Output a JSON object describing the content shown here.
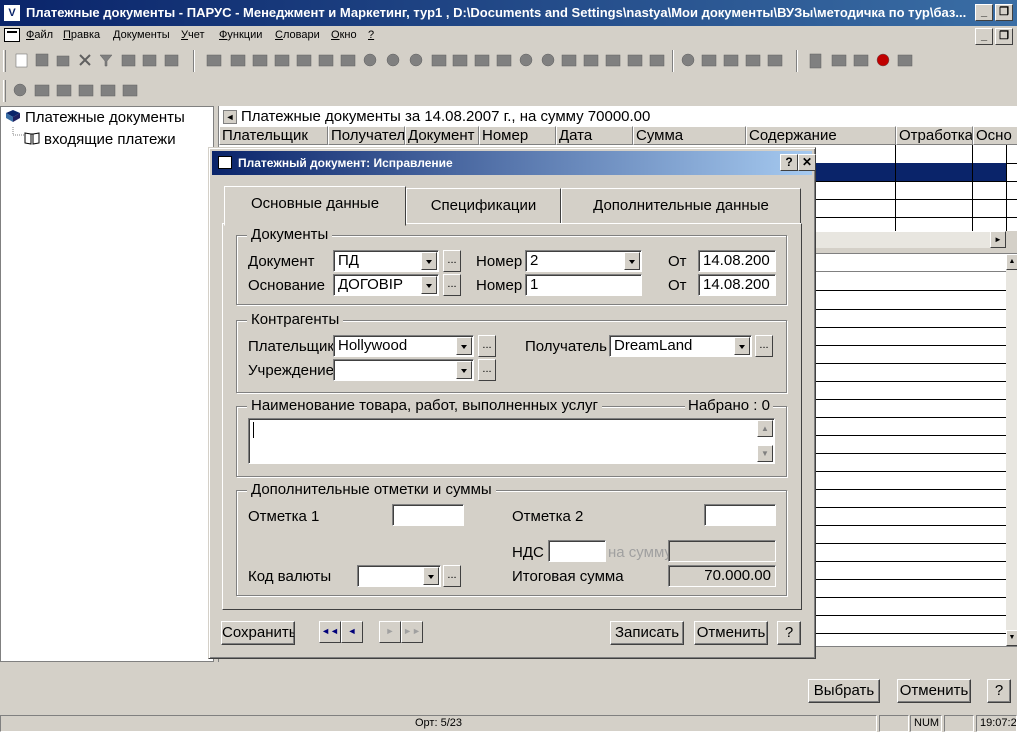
{
  "window": {
    "title": "Платежные документы - ПАРУС - Менеджмент и Маркетинг, тур1 , D:\\Documents and Settings\\nastya\\Мои документы\\ВУЗы\\методичка по тур\\баз...",
    "min_btn": "_",
    "restore_btn": "❐",
    "close_btn": "✕"
  },
  "menu": {
    "items": [
      {
        "u": "Ф",
        "rest": "айл"
      },
      {
        "u": "П",
        "rest": "равка"
      },
      {
        "u": "Д",
        "rest": "окументы"
      },
      {
        "u": "У",
        "rest": "чет"
      },
      {
        "u": "Ф",
        "rest": "ункции"
      },
      {
        "u": "С",
        "rest": "ловари"
      },
      {
        "u": "О",
        "rest": "кно"
      },
      {
        "u": "?",
        "rest": ""
      }
    ],
    "mdi_min": "_",
    "mdi_restore": "❐",
    "mdi_close": "✕"
  },
  "tree": {
    "root": "Платежные документы",
    "child": "входящие платежи"
  },
  "doclist": {
    "caption": "Платежные документы за 14.08.2007 г., на сумму 70000.00",
    "columns": [
      "Плательщик",
      "Получатель",
      "Документ",
      "Номер",
      "Дата",
      "Сумма",
      "Содержание",
      "Отработка",
      "Осно"
    ]
  },
  "dialog": {
    "title": "Платежный документ: Исправление",
    "help_btn": "?",
    "close_btn": "✕",
    "tabs": [
      "Основные данные",
      "Спецификации",
      "Дополнительные данные"
    ],
    "documents": {
      "group": "Документы",
      "doc_label": "Документ",
      "doc_value": "ПД",
      "number_label": "Номер",
      "number_value": "2",
      "from_label": "От",
      "from_value": "14.08.200",
      "basis_label": "Основание",
      "basis_value": "ДОГОВІР",
      "number2_label": "Номер",
      "number2_value": "1",
      "from2_label": "От",
      "from2_value": "14.08.200"
    },
    "contractors": {
      "group": "Контрагенты",
      "payer_label": "Плательщик",
      "payer_value": "Hollywood",
      "recipient_label": "Получатель",
      "recipient_value": "DreamLand",
      "institution_label": "Учреждение",
      "institution_value": ""
    },
    "goods": {
      "group": "Наименование товара, работ, выполненных услуг",
      "typed": "Набрано : 0",
      "value": ""
    },
    "extra": {
      "group": "Дополнительные отметки и суммы",
      "mark1_label": "Отметка 1",
      "mark1_value": "",
      "mark2_label": "Отметка 2",
      "mark2_value": "",
      "vat_label": "НДС",
      "vat_value": "",
      "on_sum_label": "на сумму",
      "on_sum_value": "",
      "currency_label": "Код валюты",
      "currency_value": "",
      "total_label": "Итоговая сумма",
      "total_value": "70.000.00"
    },
    "buttons": {
      "save": "Сохранить",
      "nav_first": "◄◄",
      "nav_prev": "◄",
      "nav_next": "►",
      "nav_last": "►►",
      "write": "Записать",
      "cancel": "Отменить",
      "help": "?"
    }
  },
  "main_buttons": {
    "select": "Выбрать",
    "cancel": "Отменить",
    "help": "?"
  },
  "status": {
    "record": "Орт: 5/23",
    "num": "NUM",
    "time": "19:07:2"
  },
  "colors": {
    "title_active": "#0a246a",
    "selection": "#0a246a",
    "face": "#d4d0c8"
  }
}
